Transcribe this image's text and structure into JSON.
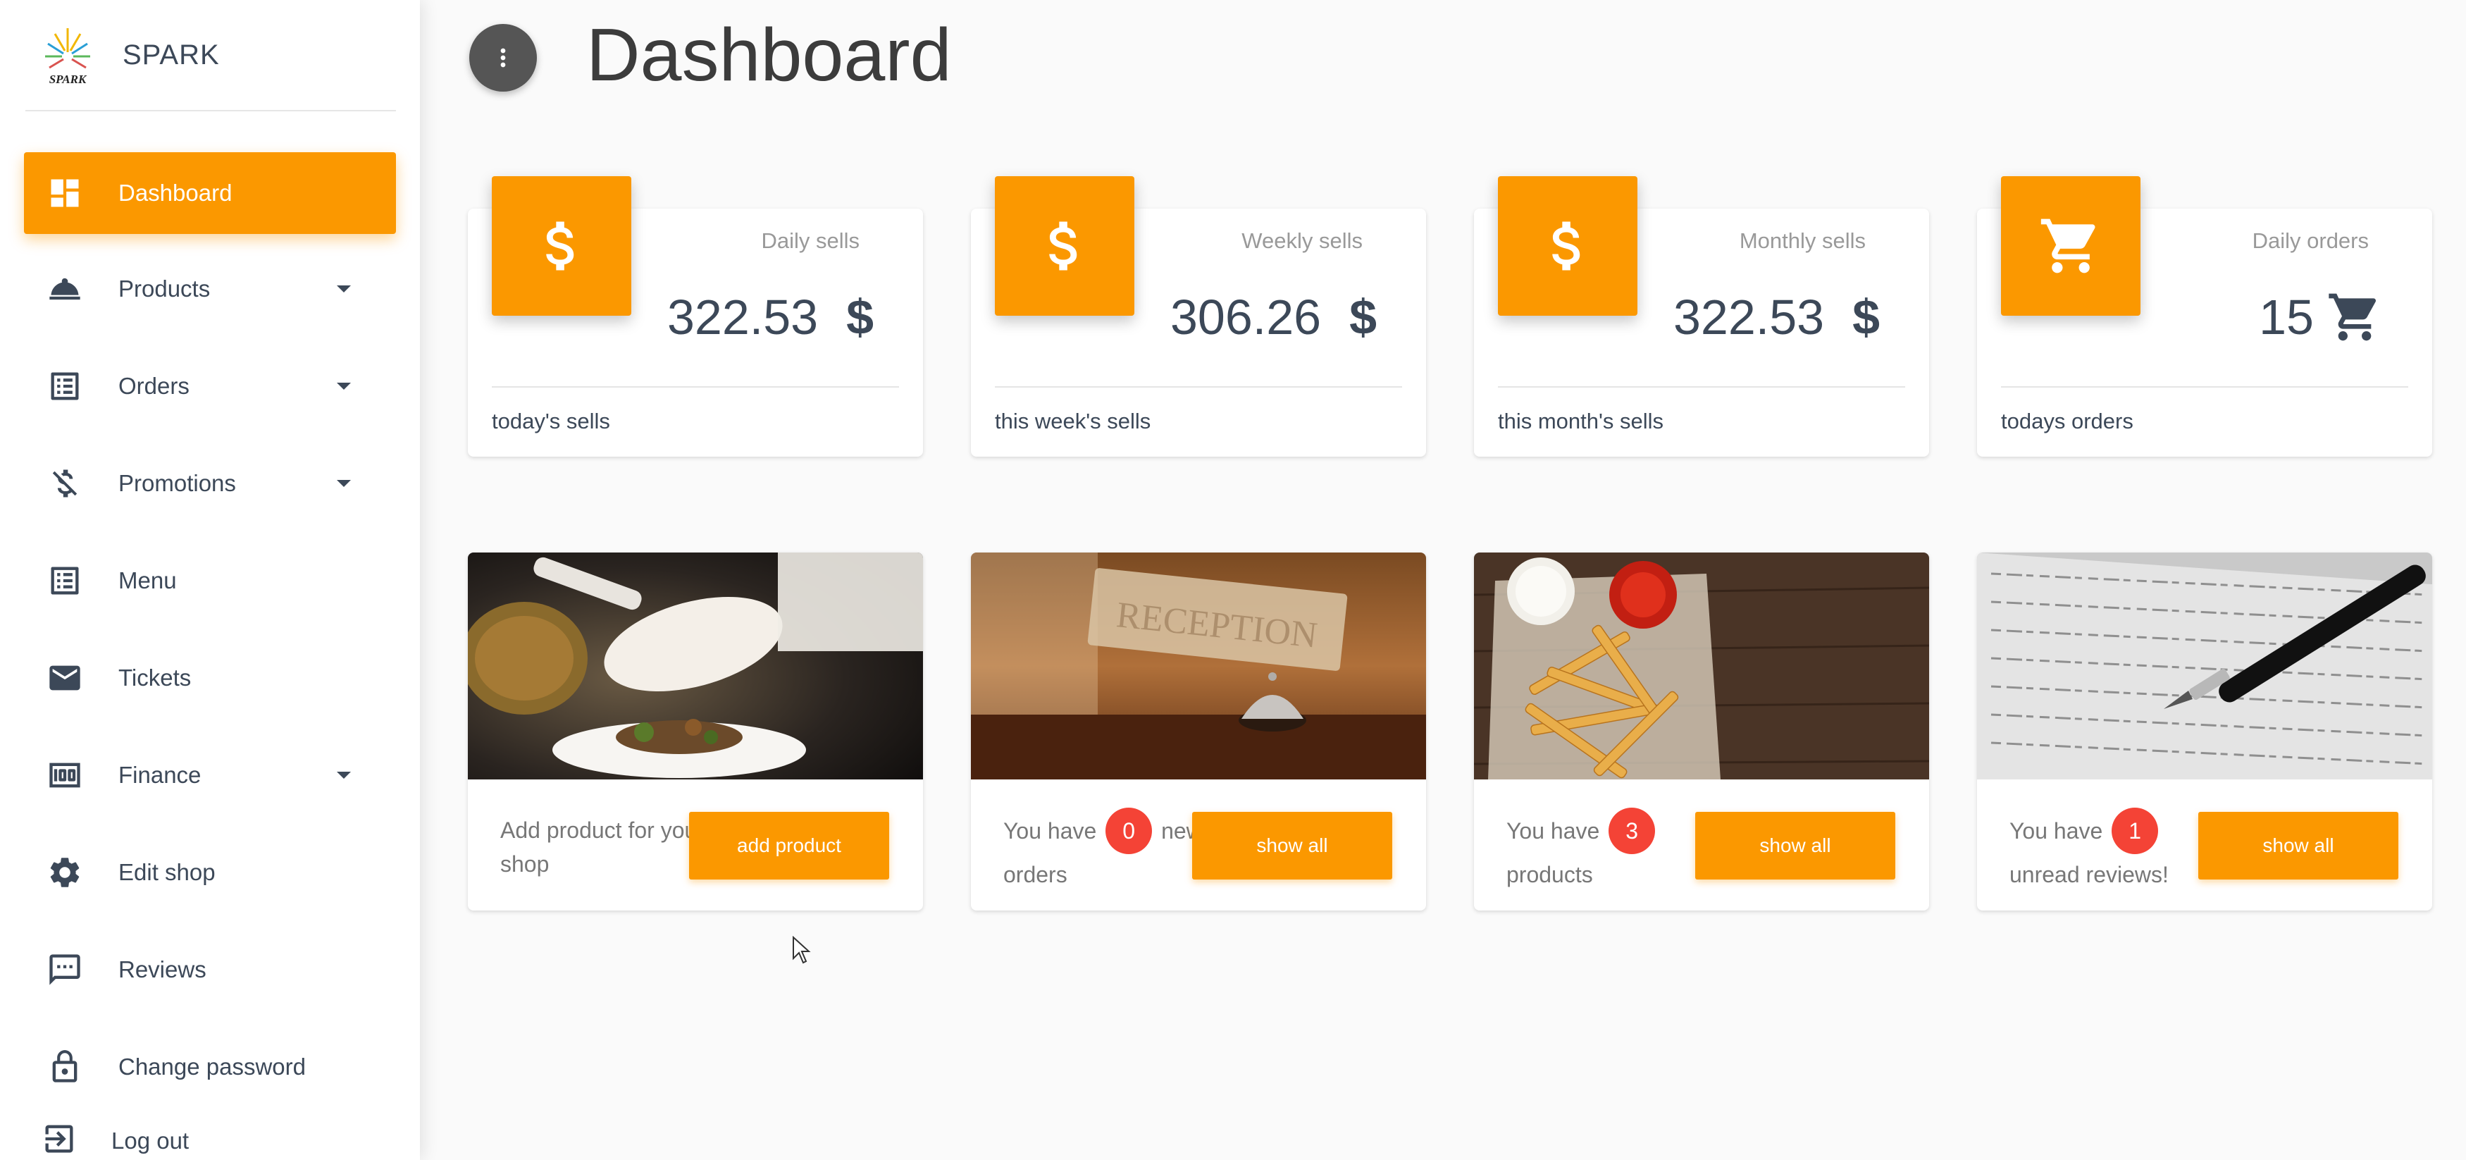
{
  "brand": {
    "name": "SPARK",
    "logo_text": "SPARK"
  },
  "sidebar": {
    "items": [
      {
        "label": "Dashboard",
        "icon": "dashboard-icon",
        "active": true
      },
      {
        "label": "Products",
        "icon": "room-service-icon",
        "has_caret": true
      },
      {
        "label": "Orders",
        "icon": "list-icon",
        "has_caret": true
      },
      {
        "label": "Promotions",
        "icon": "money-off-icon",
        "has_caret": true
      },
      {
        "label": "Menu",
        "icon": "list-icon"
      },
      {
        "label": "Tickets",
        "icon": "mail-icon"
      },
      {
        "label": "Finance",
        "icon": "money-icon",
        "has_caret": true
      },
      {
        "label": "Edit shop",
        "icon": "settings-icon"
      },
      {
        "label": "Reviews",
        "icon": "comment-icon"
      },
      {
        "label": "Change password",
        "icon": "lock-icon"
      },
      {
        "label": "Log out",
        "icon": "logout-icon"
      }
    ]
  },
  "header": {
    "title": "Dashboard"
  },
  "stats": [
    {
      "category": "Daily sells",
      "value": "322.53",
      "unit": "$",
      "footer": "today's sells",
      "icon": "dollar-icon"
    },
    {
      "category": "Weekly sells",
      "value": "306.26",
      "unit": "$",
      "footer": "this week's sells",
      "icon": "dollar-icon"
    },
    {
      "category": "Monthly sells",
      "value": "322.53",
      "unit": "$",
      "footer": "this month's sells",
      "icon": "dollar-icon"
    },
    {
      "category": "Daily orders",
      "value": "15",
      "unit": "",
      "footer": "todays orders",
      "icon": "cart-icon"
    }
  ],
  "cards": [
    {
      "text": "Add product for your shop",
      "button": "add product",
      "image": "chef-plating-photo"
    },
    {
      "pre": "You have",
      "count": "0",
      "post": "new orders",
      "button": "show all",
      "image": "reception-bell-photo"
    },
    {
      "pre": "You have",
      "count": "3",
      "post": "products",
      "button": "show all",
      "image": "fries-photo"
    },
    {
      "pre": "You have",
      "count": "1",
      "post": "unread reviews!",
      "button": "show all",
      "image": "pen-letter-photo"
    }
  ],
  "colors": {
    "accent": "#fb9800",
    "badge": "#f44336",
    "text": "#3c4858"
  }
}
